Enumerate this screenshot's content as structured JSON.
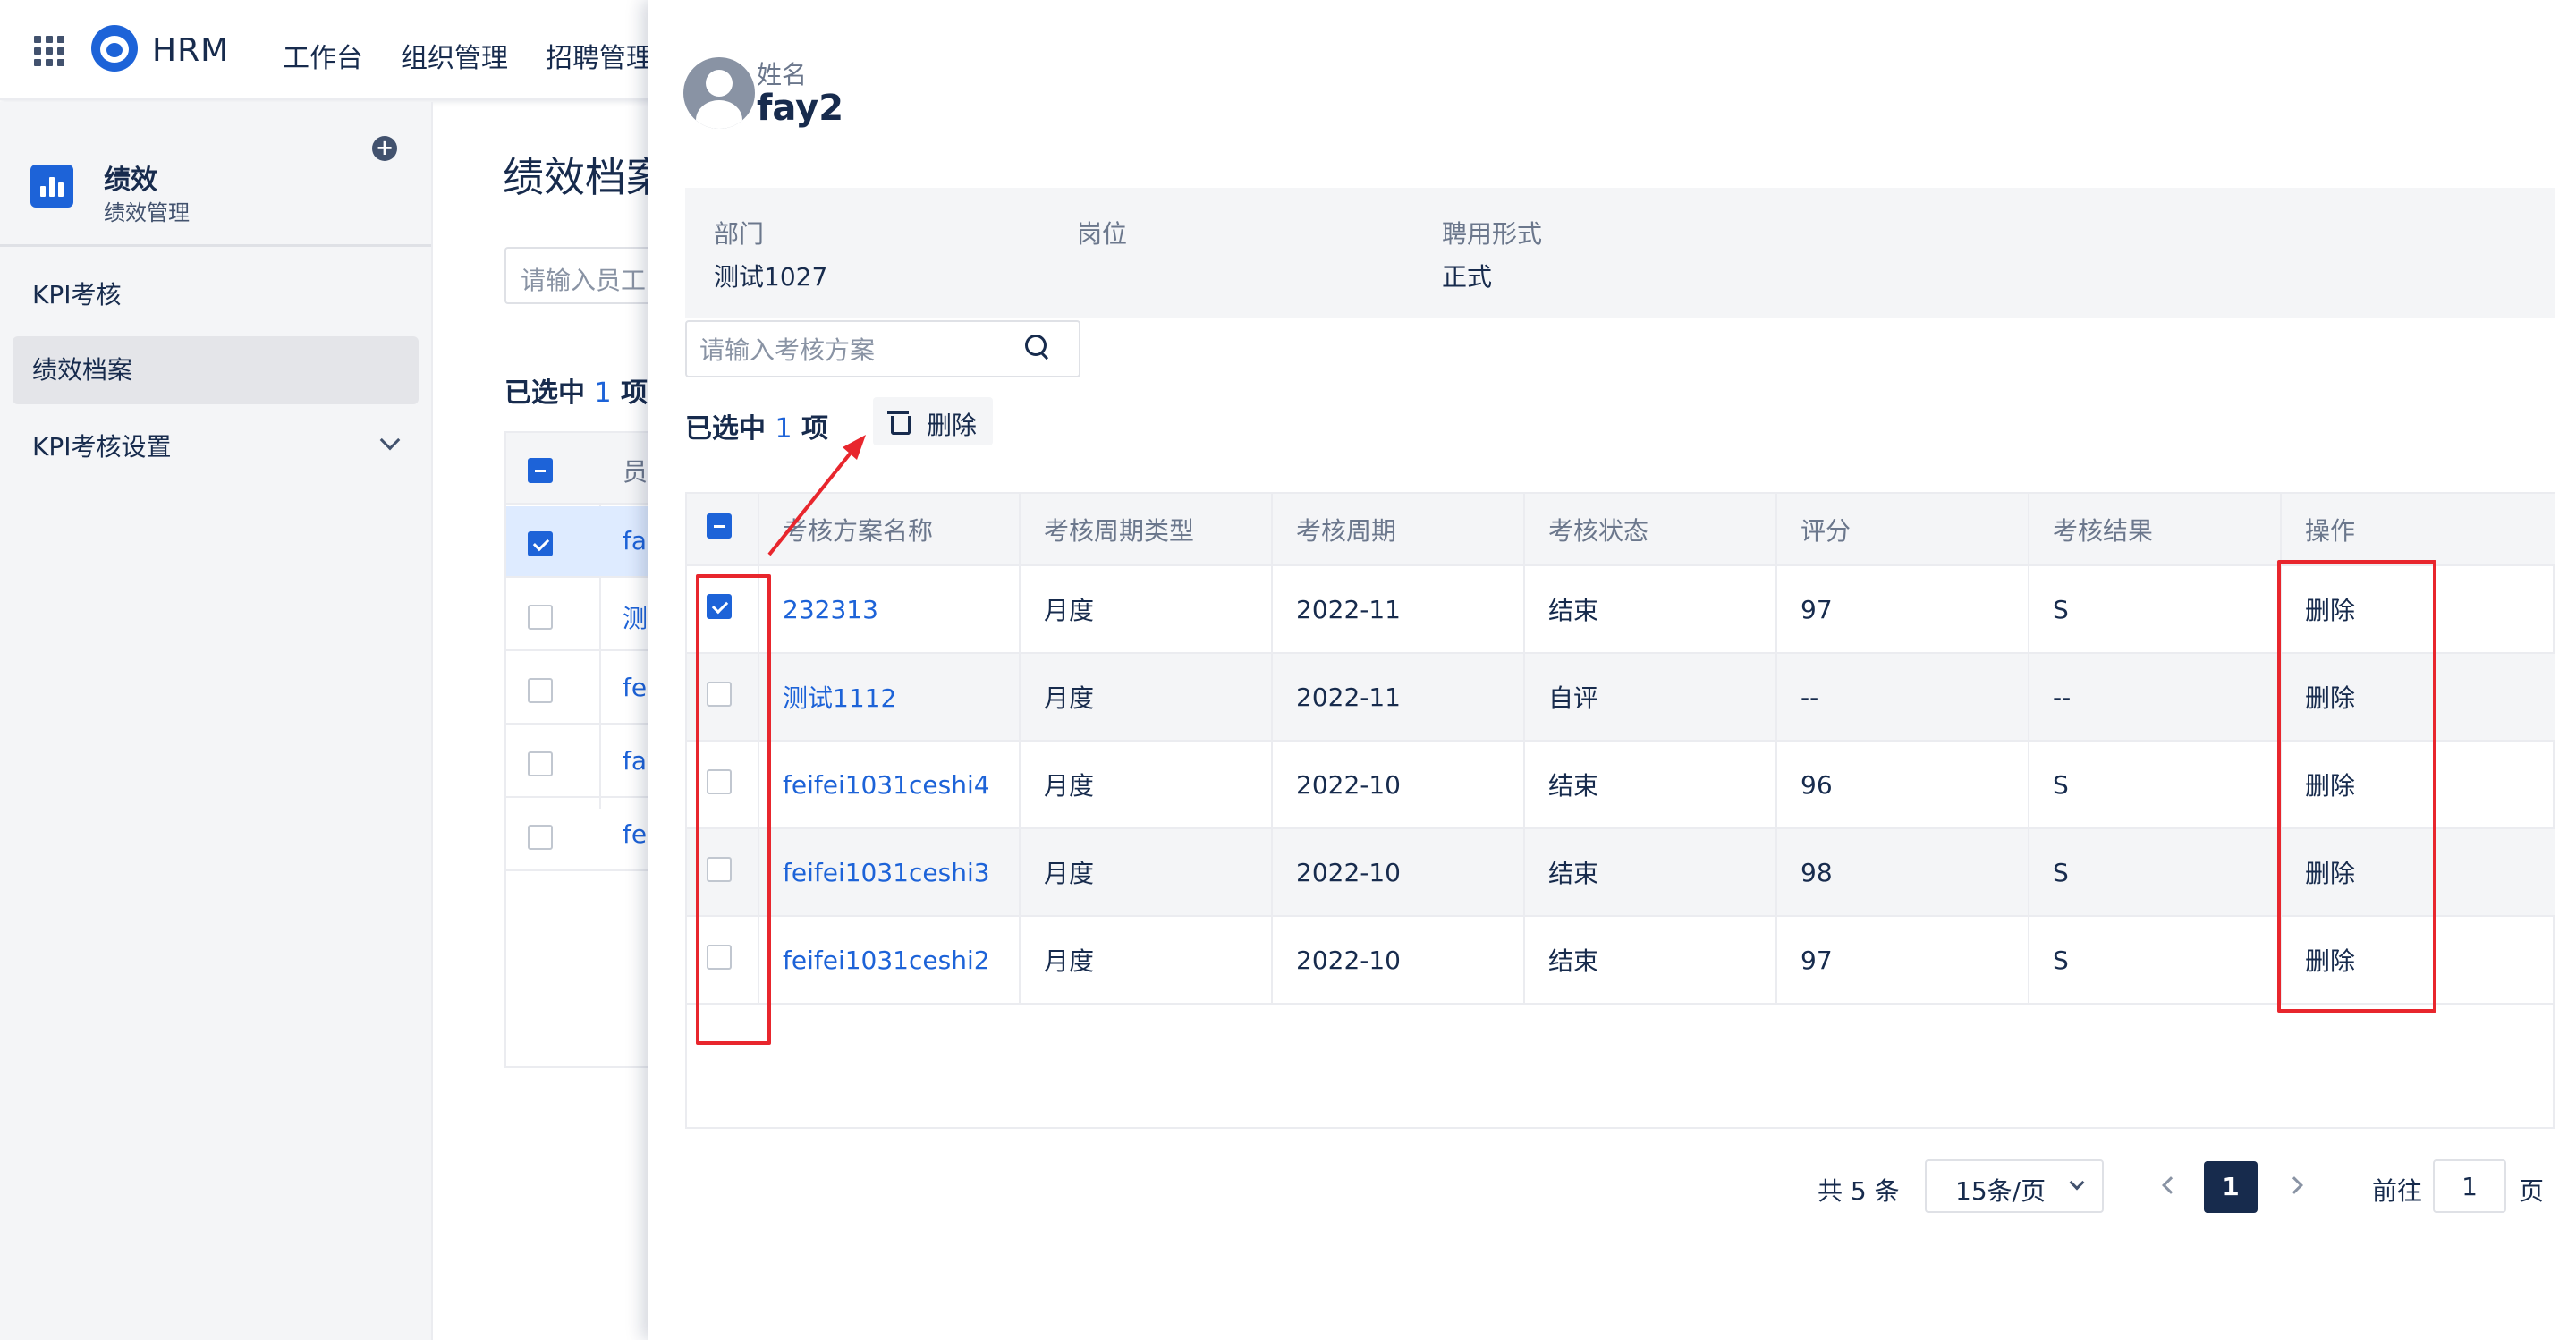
{
  "topnav": {
    "brand": "HRM",
    "items": [
      "工作台",
      "组织管理",
      "招聘管理"
    ]
  },
  "sidebar": {
    "module_title": "绩效",
    "module_subtitle": "绩效管理",
    "items": [
      {
        "label": "KPI考核",
        "active": false
      },
      {
        "label": "绩效档案",
        "active": true
      },
      {
        "label": "KPI考核设置",
        "active": false,
        "expandable": true
      }
    ]
  },
  "background": {
    "page_title": "绩效档案",
    "search_placeholder": "请输入员工",
    "selected_prefix": "已选中",
    "selected_count": "1",
    "selected_suffix": "项",
    "column_header": "员",
    "rows": [
      {
        "text": "fay",
        "checked": true
      },
      {
        "text": "测",
        "checked": false
      },
      {
        "text": "fei",
        "checked": false
      },
      {
        "text": "fay",
        "checked": false
      },
      {
        "text": "fei",
        "checked": false
      }
    ]
  },
  "drawer": {
    "name_label": "姓名",
    "name_value": "fay2",
    "info": [
      {
        "label": "部门",
        "value": "测试1027"
      },
      {
        "label": "岗位",
        "value": ""
      },
      {
        "label": "聘用形式",
        "value": "正式"
      }
    ],
    "search_placeholder": "请输入考核方案",
    "selected_prefix": "已选中",
    "selected_count": "1",
    "selected_suffix": "项",
    "delete_button": "删除",
    "columns": [
      "考核方案名称",
      "考核周期类型",
      "考核周期",
      "考核状态",
      "评分",
      "考核结果",
      "操作"
    ],
    "rows": [
      {
        "checked": true,
        "name": "232313",
        "period_type": "月度",
        "period": "2022-11",
        "status": "结束",
        "score": "97",
        "result": "S",
        "action": "删除"
      },
      {
        "checked": false,
        "name": "测试1112",
        "period_type": "月度",
        "period": "2022-11",
        "status": "自评",
        "score": "--",
        "result": "--",
        "action": "删除"
      },
      {
        "checked": false,
        "name": "feifei1031ceshi4",
        "period_type": "月度",
        "period": "2022-10",
        "status": "结束",
        "score": "96",
        "result": "S",
        "action": "删除"
      },
      {
        "checked": false,
        "name": "feifei1031ceshi3",
        "period_type": "月度",
        "period": "2022-10",
        "status": "结束",
        "score": "98",
        "result": "S",
        "action": "删除"
      },
      {
        "checked": false,
        "name": "feifei1031ceshi2",
        "period_type": "月度",
        "period": "2022-10",
        "status": "结束",
        "score": "97",
        "result": "S",
        "action": "删除"
      }
    ],
    "pagination": {
      "total_text": "共 5 条",
      "page_size": "15条/页",
      "current_page": "1",
      "goto_label": "前往",
      "goto_value": "1",
      "page_suffix": "页"
    }
  },
  "colors": {
    "primary": "#1d63d8",
    "text": "#172b4d",
    "muted": "#6b778c",
    "annotation": "#e8262d"
  }
}
